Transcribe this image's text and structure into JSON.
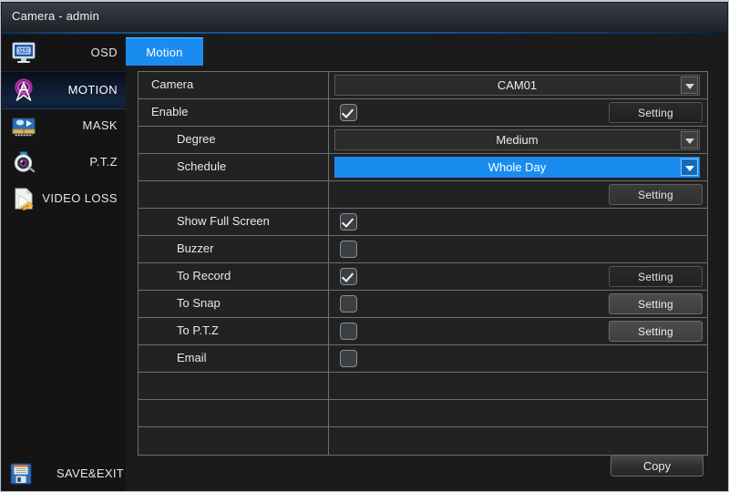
{
  "window": {
    "title": "Camera - admin"
  },
  "sidebar": {
    "items": [
      {
        "label": "OSD",
        "icon": "monitor-osd-icon",
        "active": false
      },
      {
        "label": "MOTION",
        "icon": "motion-sensor-icon",
        "active": true
      },
      {
        "label": "MASK",
        "icon": "mask-video-icon",
        "active": false
      },
      {
        "label": "P.T.Z",
        "icon": "ptz-camera-icon",
        "active": false
      },
      {
        "label": "VIDEO LOSS",
        "icon": "video-loss-icon",
        "active": false
      }
    ]
  },
  "tabs": [
    {
      "label": "Motion",
      "active": true
    }
  ],
  "table": {
    "rows": [
      {
        "label": "Camera",
        "indent": 0,
        "control": "dropdown",
        "value": "CAM01",
        "selected": false,
        "button": null
      },
      {
        "label": "Enable",
        "indent": 0,
        "control": "checkbox",
        "checked": true,
        "button": {
          "label": "Setting",
          "style": "dark"
        }
      },
      {
        "label": "Degree",
        "indent": 1,
        "control": "dropdown",
        "value": "Medium",
        "selected": false,
        "button": null
      },
      {
        "label": "Schedule",
        "indent": 1,
        "control": "dropdown",
        "value": "Whole Day",
        "selected": true,
        "button": null
      },
      {
        "label": "",
        "indent": 0,
        "control": "none",
        "button": {
          "label": "Setting",
          "style": "mid"
        }
      },
      {
        "label": "Show Full Screen",
        "indent": 1,
        "control": "checkbox",
        "checked": true,
        "button": null
      },
      {
        "label": "Buzzer",
        "indent": 1,
        "control": "checkbox",
        "checked": false,
        "button": null
      },
      {
        "label": "To Record",
        "indent": 1,
        "control": "checkbox",
        "checked": true,
        "button": {
          "label": "Setting",
          "style": "dark"
        }
      },
      {
        "label": "To Snap",
        "indent": 1,
        "control": "checkbox",
        "checked": false,
        "button": {
          "label": "Setting",
          "style": "light"
        }
      },
      {
        "label": "To P.T.Z",
        "indent": 1,
        "control": "checkbox",
        "checked": false,
        "button": {
          "label": "Setting",
          "style": "light"
        }
      },
      {
        "label": "Email",
        "indent": 1,
        "control": "checkbox",
        "checked": false,
        "button": null
      },
      {
        "label": "",
        "indent": 0,
        "control": "none",
        "button": null
      },
      {
        "label": "",
        "indent": 0,
        "control": "none",
        "button": null
      },
      {
        "label": "",
        "indent": 0,
        "control": "none",
        "button": null
      }
    ]
  },
  "footer": {
    "save_exit_label": "SAVE&EXIT",
    "save_exit_icon": "floppy-disk-icon",
    "copy_label": "Copy"
  },
  "colors": {
    "accent_blue": "#1a8cf0",
    "window_bg": "#1b1b1b",
    "sidebar_bg": "#141414",
    "table_border": "#6e6e6e",
    "text": "#e9e9e9"
  }
}
